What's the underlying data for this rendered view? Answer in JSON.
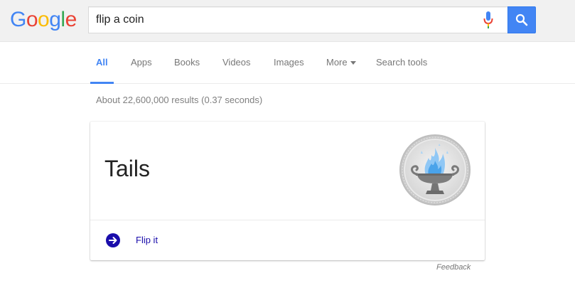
{
  "logo": {
    "letters": [
      "G",
      "o",
      "o",
      "g",
      "l",
      "e"
    ],
    "colors": [
      "#4285f4",
      "#ea4335",
      "#fbbc05",
      "#4285f4",
      "#34a853",
      "#ea4335"
    ]
  },
  "search": {
    "query": "flip a coin",
    "mic_icon": "microphone-icon",
    "button_icon": "search-icon",
    "button_color": "#4285f4"
  },
  "tabs": [
    {
      "label": "All",
      "active": true
    },
    {
      "label": "Apps",
      "active": false
    },
    {
      "label": "Books",
      "active": false
    },
    {
      "label": "Videos",
      "active": false
    },
    {
      "label": "Images",
      "active": false
    },
    {
      "label": "More",
      "active": false,
      "dropdown": true
    },
    {
      "label": "Search tools",
      "active": false
    }
  ],
  "result_stats": "About 22,600,000 results (0.37 seconds)",
  "coin_card": {
    "result": "Tails",
    "coin_icon": "coin-tails-icon",
    "action_label": "Flip it",
    "action_icon": "arrow-right-circle-icon",
    "action_color": "#1a0dab"
  },
  "feedback": "Feedback"
}
